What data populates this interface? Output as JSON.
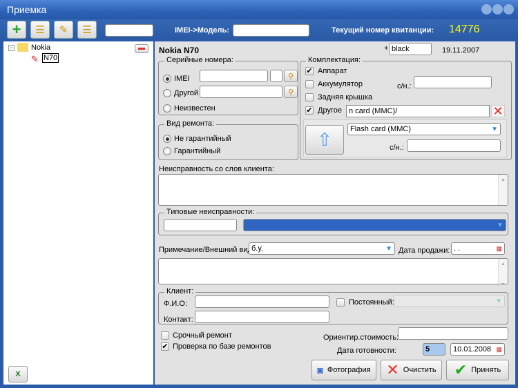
{
  "window": {
    "title": "Приемка"
  },
  "toolbar": {
    "search_value": "",
    "imei_label": "IMEI->Модель:",
    "imei_value": "",
    "receipt_label": "Текущий номер квитанции:",
    "receipt_number": "14776"
  },
  "tree": {
    "root": "Nokia",
    "child": "N70"
  },
  "device": {
    "title": "Nokia  N70",
    "color_plus": "+",
    "color": "black",
    "date": "19.11.2007"
  },
  "serials": {
    "legend": "Серийные номера:",
    "imei": "IMEI",
    "other": "Другой",
    "unknown": "Неизвестен"
  },
  "repair_type": {
    "legend": "Вид ремонта:",
    "non_warranty": "Не гарантийный",
    "warranty": "Гарантийный"
  },
  "kit": {
    "legend": "Комплектация:",
    "device": "Аппарат",
    "battery": "Аккумулятор",
    "sn_label": "с/н.:",
    "back_cover": "Задняя крышка",
    "other": "Другое",
    "other_value": "n card (MMC)/",
    "select_value": "Flash card (MMC)",
    "sn2_label": "с/н.:"
  },
  "complaint": {
    "label": "Неисправность со слов клиента:"
  },
  "typical": {
    "legend": "Типовые неисправности:"
  },
  "note": {
    "label": "Примечание/Внешний вид:",
    "value": "б.у.",
    "sale_date_label": "Дата продажи:",
    "sale_date": " .  ."
  },
  "client": {
    "legend": "Клиент:",
    "fio_label": "Ф.И.О:",
    "contact_label": "Контакт:",
    "regular_label": "Постоянный:"
  },
  "options": {
    "urgent": "Срочный ремонт",
    "check_db": "Проверка по базе ремонтов"
  },
  "cost": {
    "label": "Ориентир.стоимость:",
    "value": ""
  },
  "ready": {
    "label": "Дата готовности:",
    "days": "5",
    "date": "10.01.2008"
  },
  "buttons": {
    "photo": "Фотография",
    "clear": "Очистить",
    "accept": "Принять"
  }
}
